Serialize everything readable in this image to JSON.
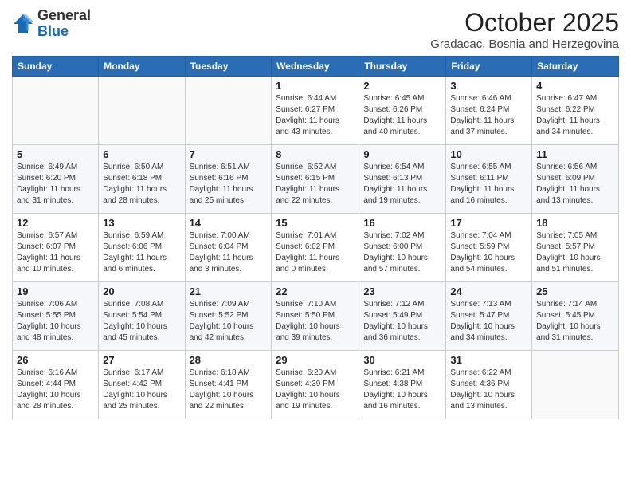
{
  "header": {
    "logo_general": "General",
    "logo_blue": "Blue",
    "month_title": "October 2025",
    "subtitle": "Gradacac, Bosnia and Herzegovina"
  },
  "days_of_week": [
    "Sunday",
    "Monday",
    "Tuesday",
    "Wednesday",
    "Thursday",
    "Friday",
    "Saturday"
  ],
  "weeks": [
    [
      {
        "day": "",
        "info": ""
      },
      {
        "day": "",
        "info": ""
      },
      {
        "day": "",
        "info": ""
      },
      {
        "day": "1",
        "info": "Sunrise: 6:44 AM\nSunset: 6:27 PM\nDaylight: 11 hours\nand 43 minutes."
      },
      {
        "day": "2",
        "info": "Sunrise: 6:45 AM\nSunset: 6:26 PM\nDaylight: 11 hours\nand 40 minutes."
      },
      {
        "day": "3",
        "info": "Sunrise: 6:46 AM\nSunset: 6:24 PM\nDaylight: 11 hours\nand 37 minutes."
      },
      {
        "day": "4",
        "info": "Sunrise: 6:47 AM\nSunset: 6:22 PM\nDaylight: 11 hours\nand 34 minutes."
      }
    ],
    [
      {
        "day": "5",
        "info": "Sunrise: 6:49 AM\nSunset: 6:20 PM\nDaylight: 11 hours\nand 31 minutes."
      },
      {
        "day": "6",
        "info": "Sunrise: 6:50 AM\nSunset: 6:18 PM\nDaylight: 11 hours\nand 28 minutes."
      },
      {
        "day": "7",
        "info": "Sunrise: 6:51 AM\nSunset: 6:16 PM\nDaylight: 11 hours\nand 25 minutes."
      },
      {
        "day": "8",
        "info": "Sunrise: 6:52 AM\nSunset: 6:15 PM\nDaylight: 11 hours\nand 22 minutes."
      },
      {
        "day": "9",
        "info": "Sunrise: 6:54 AM\nSunset: 6:13 PM\nDaylight: 11 hours\nand 19 minutes."
      },
      {
        "day": "10",
        "info": "Sunrise: 6:55 AM\nSunset: 6:11 PM\nDaylight: 11 hours\nand 16 minutes."
      },
      {
        "day": "11",
        "info": "Sunrise: 6:56 AM\nSunset: 6:09 PM\nDaylight: 11 hours\nand 13 minutes."
      }
    ],
    [
      {
        "day": "12",
        "info": "Sunrise: 6:57 AM\nSunset: 6:07 PM\nDaylight: 11 hours\nand 10 minutes."
      },
      {
        "day": "13",
        "info": "Sunrise: 6:59 AM\nSunset: 6:06 PM\nDaylight: 11 hours\nand 6 minutes."
      },
      {
        "day": "14",
        "info": "Sunrise: 7:00 AM\nSunset: 6:04 PM\nDaylight: 11 hours\nand 3 minutes."
      },
      {
        "day": "15",
        "info": "Sunrise: 7:01 AM\nSunset: 6:02 PM\nDaylight: 11 hours\nand 0 minutes."
      },
      {
        "day": "16",
        "info": "Sunrise: 7:02 AM\nSunset: 6:00 PM\nDaylight: 10 hours\nand 57 minutes."
      },
      {
        "day": "17",
        "info": "Sunrise: 7:04 AM\nSunset: 5:59 PM\nDaylight: 10 hours\nand 54 minutes."
      },
      {
        "day": "18",
        "info": "Sunrise: 7:05 AM\nSunset: 5:57 PM\nDaylight: 10 hours\nand 51 minutes."
      }
    ],
    [
      {
        "day": "19",
        "info": "Sunrise: 7:06 AM\nSunset: 5:55 PM\nDaylight: 10 hours\nand 48 minutes."
      },
      {
        "day": "20",
        "info": "Sunrise: 7:08 AM\nSunset: 5:54 PM\nDaylight: 10 hours\nand 45 minutes."
      },
      {
        "day": "21",
        "info": "Sunrise: 7:09 AM\nSunset: 5:52 PM\nDaylight: 10 hours\nand 42 minutes."
      },
      {
        "day": "22",
        "info": "Sunrise: 7:10 AM\nSunset: 5:50 PM\nDaylight: 10 hours\nand 39 minutes."
      },
      {
        "day": "23",
        "info": "Sunrise: 7:12 AM\nSunset: 5:49 PM\nDaylight: 10 hours\nand 36 minutes."
      },
      {
        "day": "24",
        "info": "Sunrise: 7:13 AM\nSunset: 5:47 PM\nDaylight: 10 hours\nand 34 minutes."
      },
      {
        "day": "25",
        "info": "Sunrise: 7:14 AM\nSunset: 5:45 PM\nDaylight: 10 hours\nand 31 minutes."
      }
    ],
    [
      {
        "day": "26",
        "info": "Sunrise: 6:16 AM\nSunset: 4:44 PM\nDaylight: 10 hours\nand 28 minutes."
      },
      {
        "day": "27",
        "info": "Sunrise: 6:17 AM\nSunset: 4:42 PM\nDaylight: 10 hours\nand 25 minutes."
      },
      {
        "day": "28",
        "info": "Sunrise: 6:18 AM\nSunset: 4:41 PM\nDaylight: 10 hours\nand 22 minutes."
      },
      {
        "day": "29",
        "info": "Sunrise: 6:20 AM\nSunset: 4:39 PM\nDaylight: 10 hours\nand 19 minutes."
      },
      {
        "day": "30",
        "info": "Sunrise: 6:21 AM\nSunset: 4:38 PM\nDaylight: 10 hours\nand 16 minutes."
      },
      {
        "day": "31",
        "info": "Sunrise: 6:22 AM\nSunset: 4:36 PM\nDaylight: 10 hours\nand 13 minutes."
      },
      {
        "day": "",
        "info": ""
      }
    ]
  ]
}
